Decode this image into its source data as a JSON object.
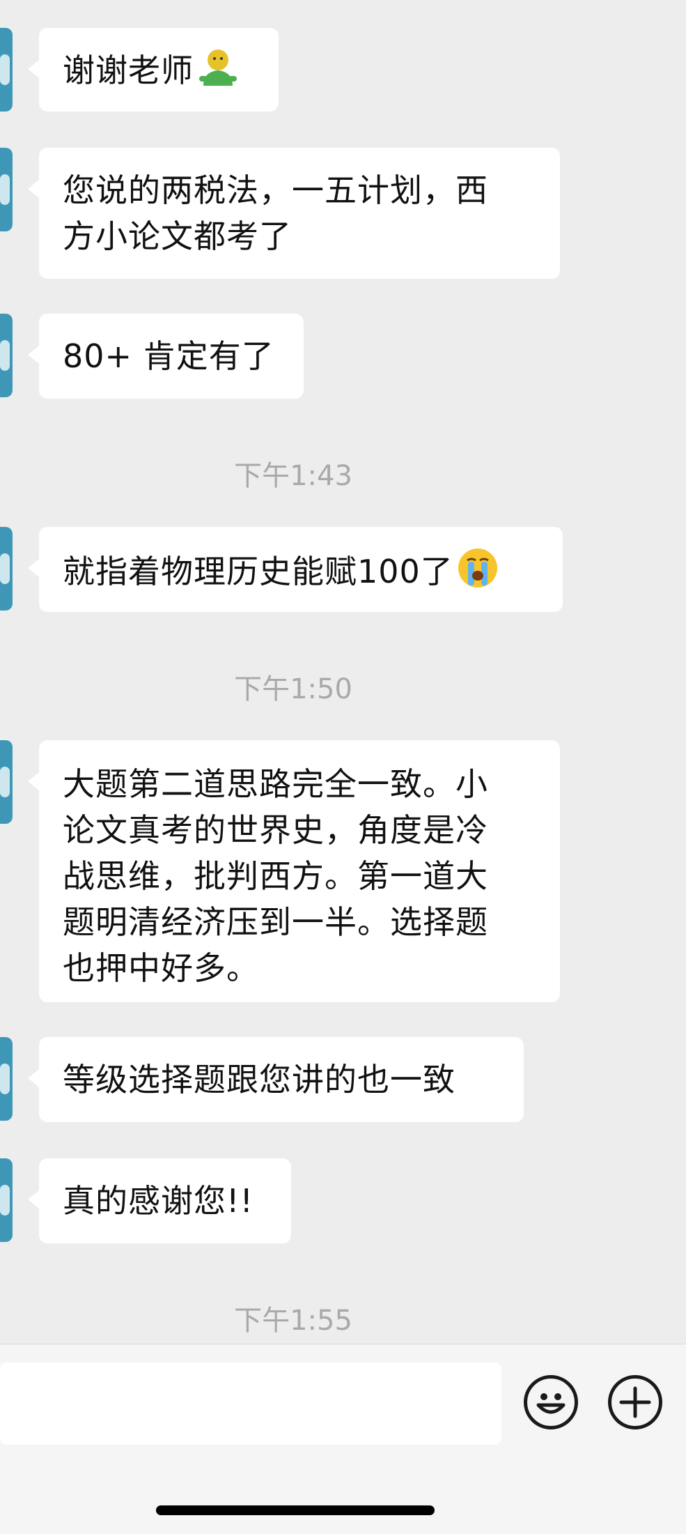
{
  "messages": [
    {
      "text": "谢谢老师",
      "emoji": "green-person-emoji"
    },
    {
      "lines": [
        "您说的两税法，一五计划，西",
        "方小论文都考了"
      ]
    },
    {
      "text": "80+ 肯定有了"
    },
    {
      "time": "下午1:43"
    },
    {
      "text": "就指着物理历史能赋100了",
      "emoji": "loudly-crying-emoji"
    },
    {
      "time": "下午1:50"
    },
    {
      "lines": [
        "大题第二道思路完全一致。小",
        "论文真考的世界史，角度是冷",
        "战思维，批判西方。第一道大",
        "题明清经济压到一半。选择题",
        "也押中好多。"
      ]
    },
    {
      "text": "等级选择题跟您讲的也一致"
    },
    {
      "text": "真的感谢您!!"
    },
    {
      "time": "下午1:55"
    }
  ],
  "input_bar": {
    "message_input_value": "",
    "emoji_button_icon": "smiley-face-icon",
    "more_button_icon": "plus-circle-icon"
  }
}
